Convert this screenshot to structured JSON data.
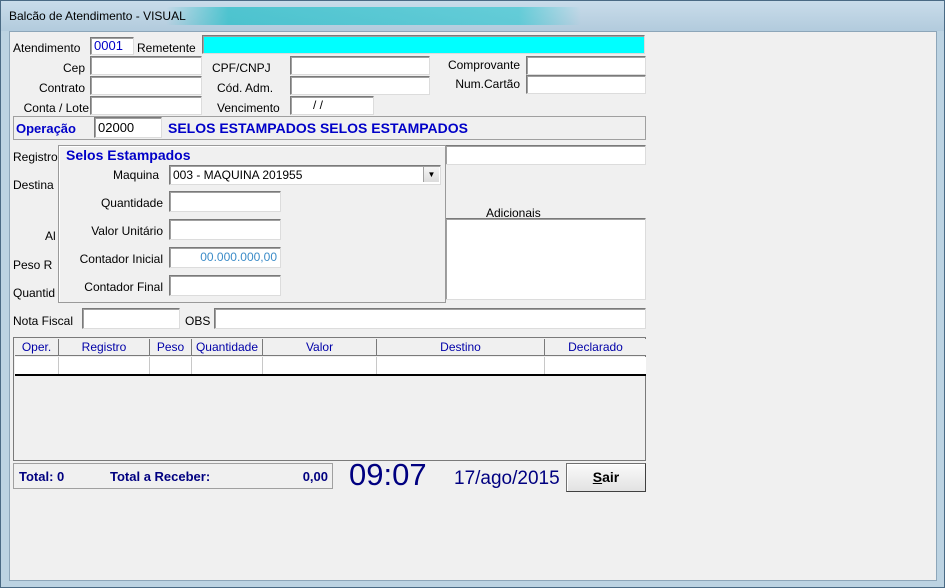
{
  "window": {
    "title": "Balcão de Atendimento - VISUAL"
  },
  "form": {
    "atendimento_label": "Atendimento",
    "atendimento_value": "0001",
    "remetente_label": "Remetente",
    "remetente_value": "",
    "cep_label": "Cep",
    "contrato_label": "Contrato",
    "conta_lote_label": "Conta / Lote",
    "cpf_cnpj_label": "CPF/CNPJ",
    "cod_adm_label": "Cód. Adm.",
    "vencimento_label": "Vencimento",
    "vencimento_value": "/     /",
    "comprovante_label": "Comprovante",
    "num_cartao_label": "Num.Cartão",
    "operacao_label": "Operação",
    "operacao_code": "02000",
    "operacao_desc": "SELOS ESTAMPADOS SELOS ESTAMPADOS",
    "registro_label": "Registro",
    "destino_label": "Destina",
    "al_label": "Al",
    "peso_label": "Peso R",
    "quantidade_label": "Quantid",
    "adicionais_label": "Adicionais",
    "nota_fiscal_label": "Nota Fiscal",
    "obs_label": "OBS"
  },
  "selos": {
    "title": "Selos Estampados",
    "maquina_label": "Maquina",
    "maquina_value": "003 - MAQUINA 201955",
    "quantidade_label": "Quantidade",
    "valor_unitario_label": "Valor Unitário",
    "contador_inicial_label": "Contador Inicial",
    "contador_inicial_value": "00.000.000,00",
    "contador_final_label": "Contador Final"
  },
  "grid": {
    "columns": [
      "Oper.",
      "Registro",
      "Peso",
      "Quantidade",
      "Valor",
      "Destino",
      "Declarado"
    ]
  },
  "footer": {
    "total_label": "Total: 0",
    "total_receber_label": "Total a Receber:",
    "total_receber_value": "0,00",
    "time": "09:07",
    "date": "17/ago/2015",
    "sair_label": "Sair"
  },
  "colors": {
    "remetente_bg": "#00ffff",
    "label_blue": "#0000c8",
    "clock_blue": "#000080",
    "contador_text": "#3c8cc8"
  }
}
